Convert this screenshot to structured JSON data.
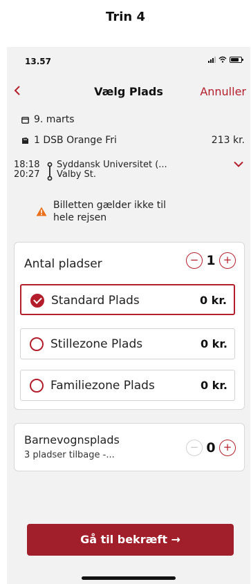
{
  "step": {
    "title": "Trin 4"
  },
  "status_bar": {
    "time": "13.57"
  },
  "nav": {
    "back_icon": "chevron-left",
    "title": "Vælg Plads",
    "cancel": "Annuller"
  },
  "trip": {
    "date": "9. marts",
    "ticket": "1 DSB Orange Fri",
    "price": "213 kr.",
    "depart_time": "18:18",
    "arrive_time": "20:27",
    "from_station": "Syddansk Universitet (...",
    "to_station": "Valby St.",
    "warning_line1": "Billetten gælder ikke til",
    "warning_line2": "hele rejsen"
  },
  "seats": {
    "count_label": "Antal pladser",
    "count_value": "1",
    "minus": "−",
    "plus": "+",
    "options": [
      {
        "label": "Standard Plads",
        "price": "0 kr.",
        "selected": true
      },
      {
        "label": "Stillezone Plads",
        "price": "0 kr.",
        "selected": false
      },
      {
        "label": "Familiezone Plads",
        "price": "0 kr.",
        "selected": false
      }
    ]
  },
  "stroller": {
    "title": "Barnevognsplads",
    "subtitle": "3 pladser tilbage -...",
    "count_value": "0",
    "minus": "−",
    "plus": "+"
  },
  "cta": {
    "label": "Gå til bekræft →"
  },
  "colors": {
    "accent": "#b41e2c",
    "cta": "#a11f2a",
    "warning": "#e8701a",
    "background": "#f2f2f2"
  }
}
